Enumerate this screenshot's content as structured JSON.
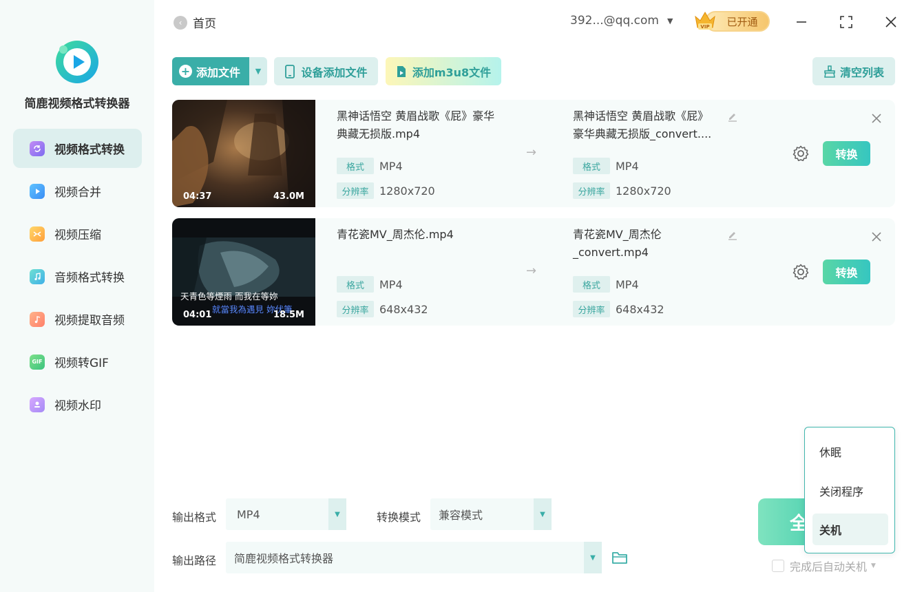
{
  "app": {
    "name": "简鹿视频格式转换器"
  },
  "sidebar": {
    "items": [
      {
        "label": "视频格式转换",
        "icon": "video-convert-icon",
        "active": true
      },
      {
        "label": "视频合并",
        "icon": "video-merge-icon"
      },
      {
        "label": "视频压缩",
        "icon": "video-compress-icon"
      },
      {
        "label": "音频格式转换",
        "icon": "audio-convert-icon"
      },
      {
        "label": "视频提取音频",
        "icon": "extract-audio-icon"
      },
      {
        "label": "视频转GIF",
        "icon": "gif-icon",
        "icon_text": "GIF"
      },
      {
        "label": "视频水印",
        "icon": "watermark-icon"
      }
    ]
  },
  "header": {
    "back_label": "首页",
    "account": "392...@qq.com",
    "vip_label": "已开通",
    "vip_badge": "VIP"
  },
  "toolbar": {
    "add_file": "添加文件",
    "device_add": "设备添加文件",
    "add_m3u8": "添加m3u8文件",
    "clear_list": "清空列表"
  },
  "files": [
    {
      "duration": "04:37",
      "size": "43.0M",
      "input_name": "黑神话悟空 黄眉战歌《屁》豪华典藏无损版.mp4",
      "output_name": "黑神话悟空 黄眉战歌《屁》豪华典藏无损版_convert....",
      "format_tag": "格式",
      "format": "MP4",
      "out_format": "MP4",
      "resolution_tag": "分辨率",
      "resolution": "1280x720",
      "out_resolution": "1280x720",
      "convert_label": "转换"
    },
    {
      "duration": "04:01",
      "size": "18.5M",
      "subtitle_line1": "天青色等煙雨  而我在等妳",
      "subtitle_line2": "就當我為遇見 妳伏筆",
      "input_name": "青花瓷MV_周杰伦.mp4",
      "output_name": "青花瓷MV_周杰伦_convert.mp4",
      "format_tag": "格式",
      "format": "MP4",
      "out_format": "MP4",
      "resolution_tag": "分辨率",
      "resolution": "648x432",
      "out_resolution": "648x432",
      "convert_label": "转换"
    }
  ],
  "settings": {
    "output_format_label": "输出格式",
    "output_format": "MP4",
    "mode_label": "转换模式",
    "mode": "兼容模式",
    "path_label": "输出路径",
    "path": "简鹿视频格式转换器"
  },
  "actions": {
    "convert_all_partial": "全",
    "auto_shutdown": "完成后自动关机"
  },
  "shutdown_menu": {
    "items": [
      "休眠",
      "关闭程序",
      "关机"
    ],
    "selected": "关机"
  },
  "colors": {
    "accent": "#3aaea8",
    "sidebar_bg": "#f5faf9",
    "active_bg": "#ddefee"
  }
}
